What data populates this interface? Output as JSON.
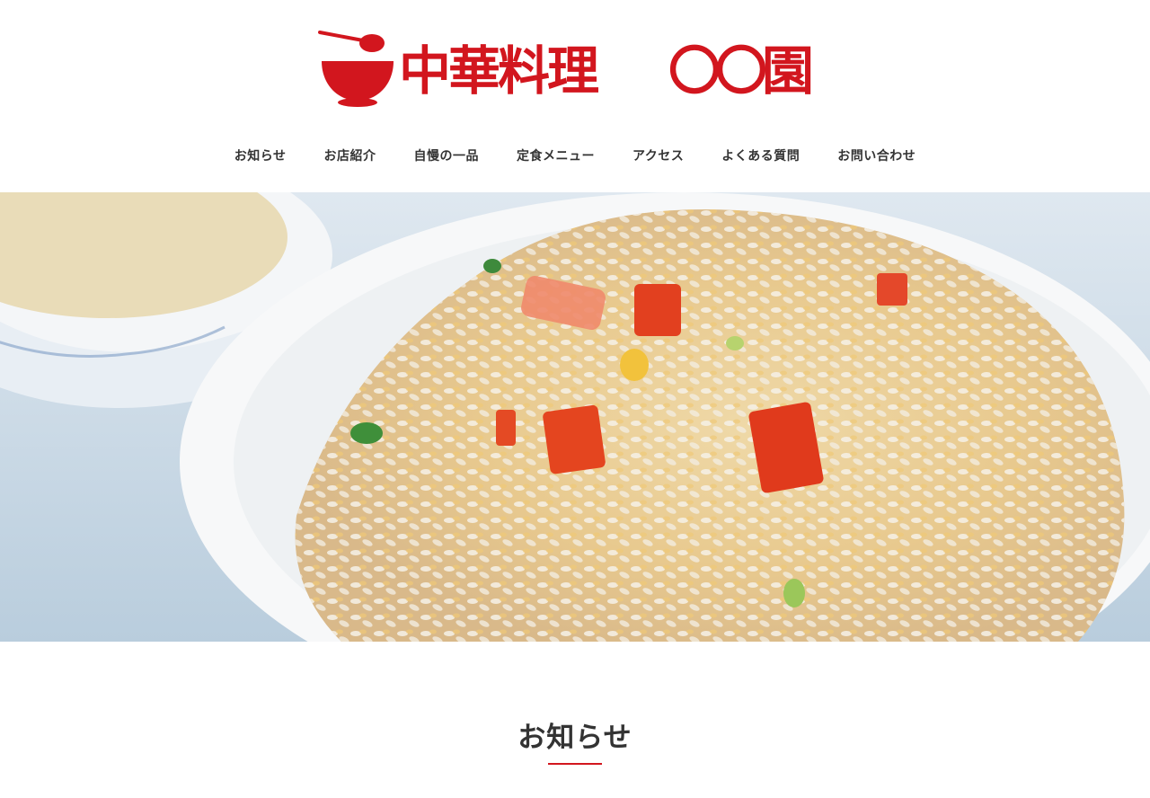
{
  "brand": {
    "name": "中華料理",
    "suffix": "〇〇園",
    "color": "#d2161e",
    "logo_icon": "bowl-with-ladle-icon"
  },
  "nav": {
    "items": [
      {
        "label": "お知らせ"
      },
      {
        "label": "お店紹介"
      },
      {
        "label": "自慢の一品"
      },
      {
        "label": "定食メニュー"
      },
      {
        "label": "アクセス"
      },
      {
        "label": "よくある質問"
      },
      {
        "label": "お問い合わせ"
      }
    ]
  },
  "hero": {
    "image": "fried-rice-photo"
  },
  "section": {
    "title": "お知らせ",
    "accent_color": "#d2161e"
  }
}
